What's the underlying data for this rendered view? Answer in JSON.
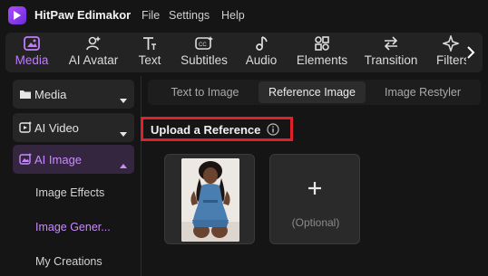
{
  "app": {
    "name": "HitPaw Edimakor"
  },
  "menu": [
    "File",
    "Settings",
    "Help"
  ],
  "toolbar": {
    "items": [
      {
        "label": "Media",
        "icon": "media-icon",
        "active": true
      },
      {
        "label": "AI Avatar",
        "icon": "ai-avatar-icon",
        "active": false
      },
      {
        "label": "Text",
        "icon": "text-icon",
        "active": false
      },
      {
        "label": "Subtitles",
        "icon": "subtitles-icon",
        "active": false
      },
      {
        "label": "Audio",
        "icon": "audio-icon",
        "active": false
      },
      {
        "label": "Elements",
        "icon": "elements-icon",
        "active": false
      },
      {
        "label": "Transition",
        "icon": "transition-icon",
        "active": false
      },
      {
        "label": "Filters",
        "icon": "filters-icon",
        "active": false
      }
    ]
  },
  "sidebar": {
    "sections": [
      {
        "label": "Media",
        "icon": "folder-icon"
      },
      {
        "label": "AI Video",
        "icon": "ai-video-icon"
      },
      {
        "label": "AI Image",
        "icon": "ai-image-icon",
        "active": true
      }
    ],
    "subitems": [
      {
        "label": "Image Effects",
        "active": false
      },
      {
        "label": "Image Gener...",
        "active": true
      },
      {
        "label": "My Creations",
        "active": false
      }
    ]
  },
  "tabs": [
    {
      "label": "Text to Image",
      "active": false
    },
    {
      "label": "Reference Image",
      "active": true
    },
    {
      "label": "Image Restyler",
      "active": false
    }
  ],
  "upload": {
    "title": "Upload a Reference",
    "optional_label": "(Optional)"
  },
  "colors": {
    "accent": "#c07bff",
    "highlight_box": "#e0202a",
    "background": "#151515"
  }
}
